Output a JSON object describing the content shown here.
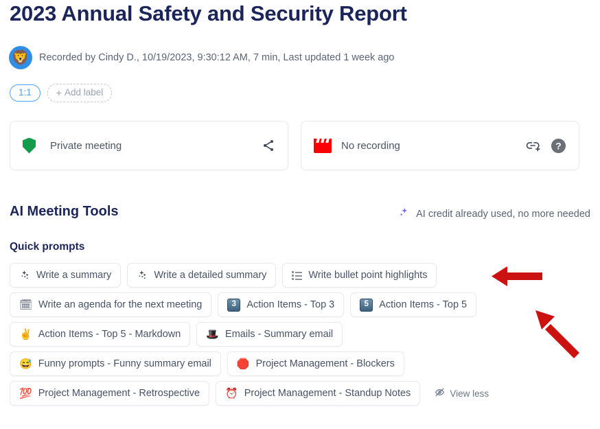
{
  "header": {
    "title": "2023 Annual Safety and Security Report",
    "avatar_icon": "lion-avatar",
    "meta": "Recorded by Cindy D., 10/19/2023, 9:30:12 AM, 7 min, Last updated 1 week ago",
    "label_pill": "1:1",
    "add_label": "Add label",
    "add_label_plus": "+"
  },
  "cards": [
    {
      "icon": "shield-icon",
      "text": "Private meeting",
      "actions": [
        {
          "icon": "share-icon"
        }
      ]
    },
    {
      "icon": "clapperboard-icon",
      "text": "No recording",
      "actions": [
        {
          "icon": "add-link-icon"
        },
        {
          "icon": "help-circle-icon"
        }
      ]
    }
  ],
  "ai_section": {
    "heading": "AI Meeting Tools",
    "credit_icon": "sparkle-icon",
    "credit_text": "AI credit already used, no more needed",
    "quick_prompts_heading": "Quick prompts",
    "view_less": "View less",
    "view_less_icon": "eye-off-icon"
  },
  "chip_rows": [
    [
      {
        "icon": "magic-wand-icon",
        "icon_type": "magic",
        "label": "Write a summary"
      },
      {
        "icon": "magic-wand-icon",
        "icon_type": "magic",
        "label": "Write a detailed summary"
      },
      {
        "icon": "bullet-list-icon",
        "icon_type": "list",
        "label": "Write bullet point highlights"
      }
    ],
    [
      {
        "icon": "calendar-icon",
        "icon_type": "emoji",
        "glyph": "🗓",
        "label": "Write an agenda for the next meeting"
      },
      {
        "icon": "keycap-3-icon",
        "icon_type": "keycap",
        "glyph": "3",
        "label": "Action Items - Top 3"
      },
      {
        "icon": "keycap-5-icon",
        "icon_type": "keycap",
        "glyph": "5",
        "label": "Action Items - Top 5"
      }
    ],
    [
      {
        "icon": "victory-hand-icon",
        "icon_type": "emoji",
        "glyph": "✌️",
        "label": "Action Items - Top 5 - Markdown"
      },
      {
        "icon": "top-hat-icon",
        "icon_type": "emoji",
        "glyph": "🎩",
        "label": "Emails - Summary email"
      }
    ],
    [
      {
        "icon": "sweat-smile-icon",
        "icon_type": "emoji",
        "glyph": "😅",
        "label": "Funny prompts - Funny summary email"
      },
      {
        "icon": "stop-sign-icon",
        "icon_type": "emoji",
        "glyph": "🛑",
        "label": "Project Management - Blockers"
      }
    ],
    [
      {
        "icon": "hundred-points-icon",
        "icon_type": "emoji",
        "glyph": "💯",
        "label": "Project Management - Retrospective"
      },
      {
        "icon": "alarm-clock-icon",
        "icon_type": "emoji",
        "glyph": "⏰",
        "label": "Project Management - Standup Notes"
      }
    ]
  ],
  "annotations": {
    "arrow_color": "#cc1111",
    "arrow_horizontal": "points-left-at-write-bullet-point-highlights",
    "arrow_diagonal": "points-up-left-at-action-items-top-5"
  },
  "colors": {
    "title": "#1b2559",
    "accent_blue": "#4da3f5",
    "shield_green": "#159b4c",
    "clapper_red": "#fb0006",
    "sparkle_purple": "#7b68f0",
    "arrow_red": "#cc1111"
  }
}
